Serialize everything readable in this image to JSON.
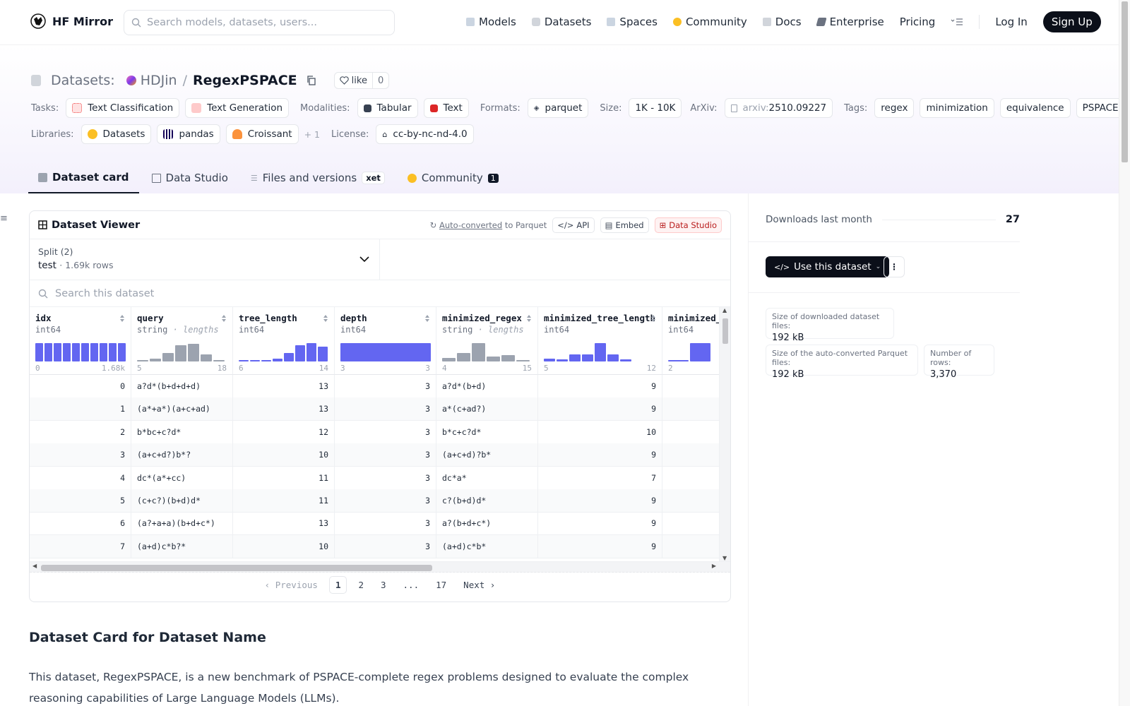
{
  "nav": {
    "brand": "HF Mirror",
    "search_placeholder": "Search models, datasets, users...",
    "items": [
      {
        "label": "Models",
        "icon": "models-icon",
        "color": "#9ca3af"
      },
      {
        "label": "Datasets",
        "icon": "datasets-icon",
        "color": "#d1d5db"
      },
      {
        "label": "Spaces",
        "icon": "spaces-icon",
        "color": "#9ca3af"
      },
      {
        "label": "Community",
        "icon": "community-icon",
        "color": "#fbbf24"
      },
      {
        "label": "Docs",
        "icon": "docs-icon",
        "color": "#d1d5db"
      },
      {
        "label": "Enterprise",
        "icon": "enterprise-icon",
        "color": "#6b7280"
      }
    ],
    "pricing": "Pricing",
    "login": "Log In",
    "signup": "Sign Up"
  },
  "header": {
    "section": "Datasets:",
    "owner": "HDJin",
    "repo": "RegexPSPACE",
    "like_label": "like",
    "like_count": "0",
    "tasks_label": "Tasks:",
    "tasks": [
      "Text Classification",
      "Text Generation"
    ],
    "modalities_label": "Modalities:",
    "modalities": [
      "Tabular",
      "Text"
    ],
    "formats_label": "Formats:",
    "formats": [
      "parquet"
    ],
    "size_label": "Size:",
    "size": "1K - 10K",
    "arxiv_label": "ArXiv:",
    "arxiv_prefix": "arxiv:",
    "arxiv_id": "2510.09227",
    "tags_label": "Tags:",
    "tags": [
      "regex",
      "minimization",
      "equivalence",
      "PSPACE"
    ],
    "libraries_label": "Libraries:",
    "libraries": [
      "Datasets",
      "pandas",
      "Croissant"
    ],
    "libraries_more": "+ 1",
    "license_label": "License:",
    "license": "cc-by-nc-nd-4.0"
  },
  "tabs": [
    {
      "label": "Dataset card",
      "active": true
    },
    {
      "label": "Data Studio"
    },
    {
      "label": "Files and versions",
      "badge": "xet"
    },
    {
      "label": "Community",
      "count": "1"
    }
  ],
  "viewer": {
    "title": "Dataset Viewer",
    "auto_converted": "Auto-converted",
    "to_parquet": "to Parquet",
    "api": "API",
    "embed": "Embed",
    "data_studio": "Data Studio",
    "split_label": "Split (2)",
    "split_name": "test",
    "split_rows": "1.69k rows",
    "search_placeholder": "Search this dataset",
    "columns": [
      {
        "name": "idx",
        "type": "int64",
        "min": "0",
        "max": "1.68k",
        "color": "#6366f1",
        "hist": [
          1,
          1,
          1,
          1,
          1,
          1,
          1,
          1,
          1,
          1
        ]
      },
      {
        "name": "query",
        "type": "string",
        "sub": "lengths",
        "min": "5",
        "max": "18",
        "color": "#9ca3af",
        "hist": [
          0.05,
          0.15,
          0.45,
          0.9,
          0.95,
          0.4,
          0.04
        ]
      },
      {
        "name": "tree_length",
        "type": "int64",
        "min": "6",
        "max": "14",
        "color": "#6366f1",
        "hist": [
          0.03,
          0.05,
          0.08,
          0.15,
          0.45,
          0.9,
          1,
          0.8
        ]
      },
      {
        "name": "depth",
        "type": "int64",
        "min": "3",
        "max": "3",
        "color": "#6366f1",
        "hist": [
          1
        ]
      },
      {
        "name": "minimized_regex",
        "type": "string",
        "sub": "lengths",
        "min": "4",
        "max": "15",
        "color": "#9ca3af",
        "hist": [
          0.2,
          0.45,
          1,
          0.25,
          0.35,
          0.05
        ]
      },
      {
        "name": "minimized_tree_length",
        "type": "int64",
        "min": "5",
        "max": "12",
        "color": "#6366f1",
        "hist": [
          0.15,
          0.1,
          0.4,
          0.4,
          1,
          0.4,
          0.1
        ]
      },
      {
        "name": "minimized_depth",
        "type": "int64",
        "min": "2",
        "max": "",
        "color": "#6366f1",
        "hist": [
          0.06,
          1
        ]
      }
    ],
    "rows": [
      [
        "0",
        "a?d*(b+d+d+d)",
        "13",
        "3",
        "a?d*(b+d)",
        "9"
      ],
      [
        "1",
        "(a*+a*)(a+c+ad)",
        "13",
        "3",
        "a*(c+ad?)",
        "9"
      ],
      [
        "2",
        "b*bc+c?d*",
        "12",
        "3",
        "b*c+c?d*",
        "10"
      ],
      [
        "3",
        "(a+c+d?)b*?",
        "10",
        "3",
        "(a+c+d)?b*",
        "9"
      ],
      [
        "4",
        "dc*(a*+cc)",
        "11",
        "3",
        "dc*a*",
        "7"
      ],
      [
        "5",
        "(c+c?)(b+d)d*",
        "11",
        "3",
        "c?(b+d)d*",
        "9"
      ],
      [
        "6",
        "(a?+a+a)(b+d+c*)",
        "13",
        "3",
        "a?(b+d+c*)",
        "9"
      ],
      [
        "7",
        "(a+d)c*b?*",
        "10",
        "3",
        "(a+d)c*b*",
        "9"
      ]
    ],
    "pager": {
      "previous": "Previous",
      "pages": [
        "1",
        "2",
        "3",
        "...",
        "17"
      ],
      "next": "Next"
    }
  },
  "card": {
    "title": "Dataset Card for Dataset Name",
    "text": "This dataset, RegexPSPACE, is a new benchmark of PSPACE-complete regex problems designed to evaluate the complex reasoning capabilities of Large Language Models (LLMs)."
  },
  "sidebar": {
    "downloads_label": "Downloads last month",
    "downloads": "27",
    "use_button": "Use this dataset",
    "stats": [
      {
        "label": "Size of downloaded dataset files:",
        "value": "192 kB"
      },
      {
        "label": "Size of the auto-converted Parquet files:",
        "value": "192 kB"
      },
      {
        "label": "Number of rows:",
        "value": "3,370"
      }
    ]
  }
}
